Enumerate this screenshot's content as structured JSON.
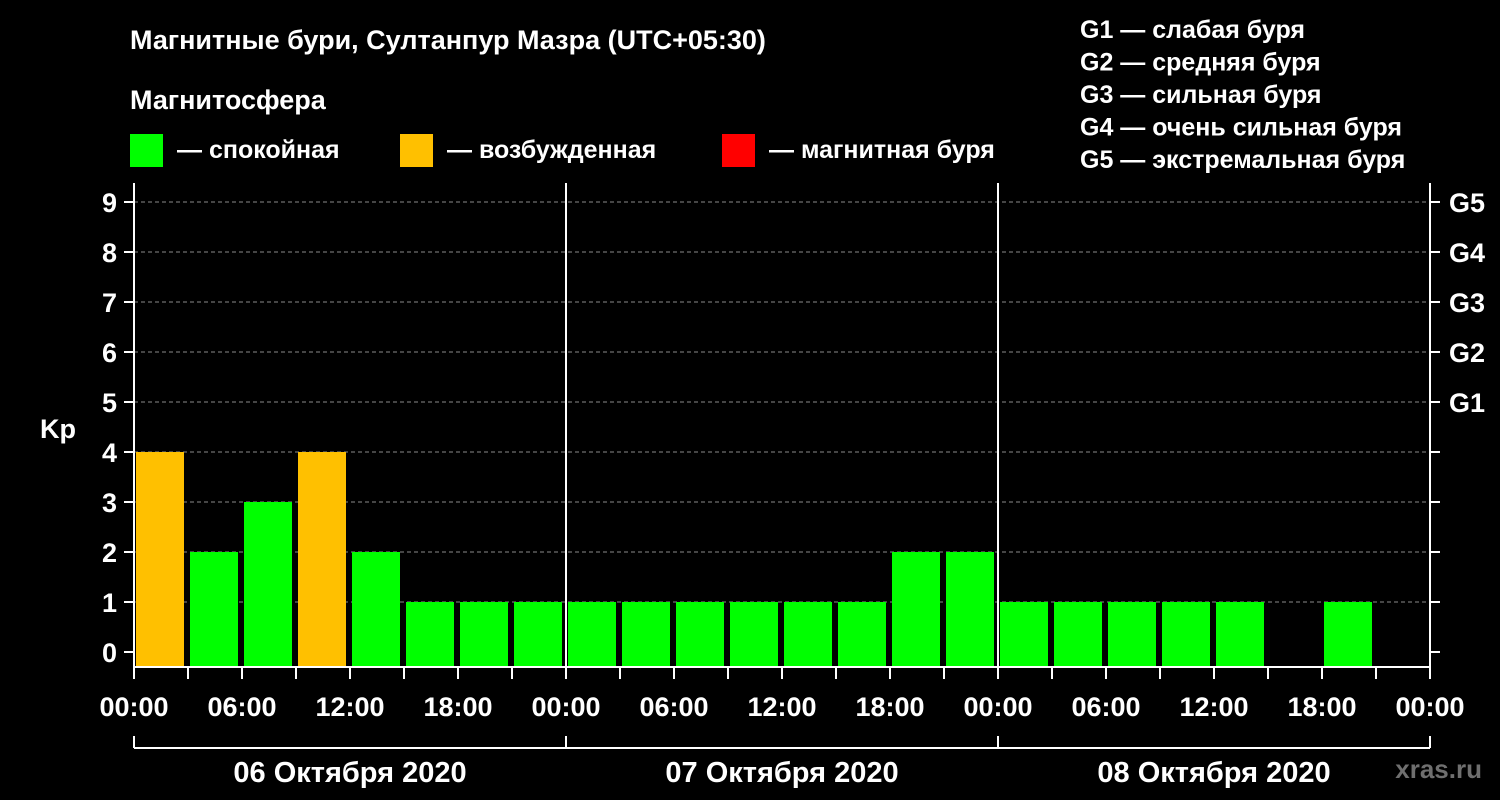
{
  "chart_data": {
    "type": "bar",
    "title": "Магнитные бури, Султанпур Мазра (UTC+05:30)",
    "subtitle": "Магнитосфера",
    "ylabel": "Kp",
    "ylim": [
      0,
      9
    ],
    "y_ticks": [
      "0",
      "1",
      "2",
      "3",
      "4",
      "5",
      "6",
      "7",
      "8",
      "9"
    ],
    "x_tick_labels": [
      "00:00",
      "06:00",
      "12:00",
      "18:00",
      "00:00",
      "06:00",
      "12:00",
      "18:00",
      "00:00",
      "06:00",
      "12:00",
      "18:00",
      "00:00"
    ],
    "dates": [
      "06 Октября 2020",
      "07 Октября 2020",
      "08 Октября 2020"
    ],
    "interval_hours": 3,
    "values": [
      4,
      2,
      3,
      4,
      2,
      1,
      1,
      1,
      1,
      1,
      1,
      1,
      1,
      1,
      2,
      2,
      1,
      1,
      1,
      1,
      1,
      null,
      1,
      null
    ],
    "statuses": [
      "excited",
      "calm",
      "calm",
      "excited",
      "calm",
      "calm",
      "calm",
      "calm",
      "calm",
      "calm",
      "calm",
      "calm",
      "calm",
      "calm",
      "calm",
      "calm",
      "calm",
      "calm",
      "calm",
      "calm",
      "calm",
      null,
      "calm",
      null
    ],
    "legend": [
      {
        "key": "calm",
        "label": "— спокойная",
        "color": "#00ff00"
      },
      {
        "key": "excited",
        "label": "— возбужденная",
        "color": "#ffc000"
      },
      {
        "key": "storm",
        "label": "— магнитная буря",
        "color": "#ff0000"
      }
    ],
    "g_levels": [
      {
        "label": "G1",
        "kp": 5,
        "description": "G1 — слабая буря"
      },
      {
        "label": "G2",
        "kp": 6,
        "description": "G2 — средняя буря"
      },
      {
        "label": "G3",
        "kp": 7,
        "description": "G3 — сильная буря"
      },
      {
        "label": "G4",
        "kp": 8,
        "description": "G4 — очень сильная буря"
      },
      {
        "label": "G5",
        "kp": 9,
        "description": "G5 — экстремальная буря"
      }
    ],
    "grid": true,
    "watermark": "xras.ru"
  }
}
